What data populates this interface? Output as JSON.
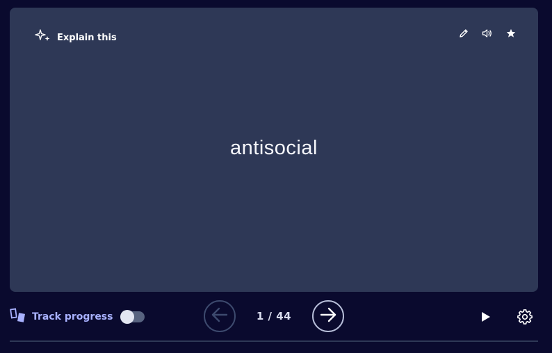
{
  "card": {
    "explain_label": "Explain this",
    "term": "antisocial",
    "actions": {
      "edit_icon": "pencil-icon",
      "audio_icon": "speaker-icon",
      "star_icon": "star-icon"
    }
  },
  "controls": {
    "track_progress_label": "Track progress",
    "track_progress_enabled": false,
    "counter": "1 / 44",
    "prev_icon": "arrow-left-icon",
    "next_icon": "arrow-right-icon",
    "play_icon": "play-icon",
    "settings_icon": "gear-icon"
  },
  "colors": {
    "page_bg": "#0a0a2e",
    "card_bg": "#2e3856",
    "accent": "#a8b1ff"
  }
}
